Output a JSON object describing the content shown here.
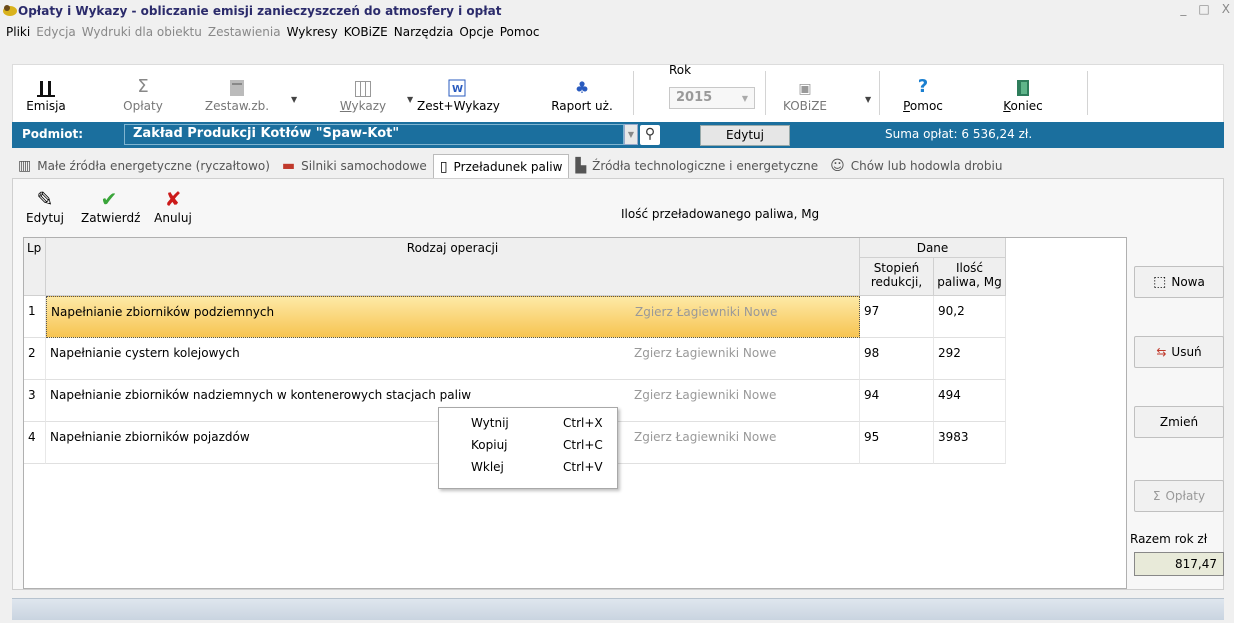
{
  "window": {
    "title": "Opłaty i Wykazy  - obliczanie emisji zanieczyszczeń do atmosfery i opłat",
    "controls": [
      "_",
      "□",
      "X"
    ]
  },
  "menu": [
    {
      "label": "Pliki",
      "enabled": true
    },
    {
      "label": "Edycja",
      "enabled": false
    },
    {
      "label": "Wydruki dla obiektu",
      "enabled": false
    },
    {
      "label": "Zestawienia",
      "enabled": false
    },
    {
      "label": "Wykresy",
      "enabled": true
    },
    {
      "label": "KOBiZE",
      "enabled": true
    },
    {
      "label": "Narzędzia",
      "enabled": true
    },
    {
      "label": "Opcje",
      "enabled": true
    },
    {
      "label": "Pomoc",
      "enabled": true
    }
  ],
  "toolbar": {
    "emisja": "Emisja",
    "oplaty": "Opłaty",
    "zestaw": "Zestaw.zb.",
    "wykazy": "Wykazy",
    "zest_wykazy": "Zest+Wykazy",
    "raport": "Raport uż.",
    "rok_label": "Rok",
    "rok_value": "2015",
    "kobize": "KOBiZE",
    "pomoc": "Pomoc",
    "koniec": "Koniec"
  },
  "subject": {
    "label": "Podmiot:",
    "value": "Zakład Produkcji Kotłów \"Spaw-Kot\"",
    "edit_button": "Edytuj",
    "sum_text": "Suma opłat:  6 536,24 zł."
  },
  "tabs": [
    {
      "label": "Małe źródła energetyczne (ryczałtowo)",
      "icon": "building-icon",
      "active": false
    },
    {
      "label": "Silniki samochodowe",
      "icon": "car-icon",
      "active": false
    },
    {
      "label": "Przeładunek paliw",
      "icon": "fuel-pump-icon",
      "active": true
    },
    {
      "label": "Źródła technologiczne i energetyczne",
      "icon": "factory-icon",
      "active": false
    },
    {
      "label": "Chów lub hodowla drobiu",
      "icon": "bird-icon",
      "active": false
    }
  ],
  "actions": {
    "edytuj": "Edytuj",
    "zatwierdz": "Zatwierdź",
    "anuluj": "Anuluj"
  },
  "panel_title": "Ilość przeładowanego paliwa, Mg",
  "grid": {
    "headers": {
      "lp": "Lp",
      "rodzaj": "Rodzaj operacji",
      "dane": "Dane",
      "stopien_1": "Stopień",
      "stopien_2": "redukcji,",
      "ilosc_1": "Ilość",
      "ilosc_2": "paliwa, Mg"
    },
    "rows": [
      {
        "lp": "1",
        "rodzaj": "Napełnianie zbiorników podziemnych",
        "lokalizacja": "Zgierz Łagiewniki Nowe",
        "stopien": "97",
        "ilosc": "90,2",
        "selected": true
      },
      {
        "lp": "2",
        "rodzaj": "Napełnianie cystern kolejowych",
        "lokalizacja": "Zgierz Łagiewniki Nowe",
        "stopien": "98",
        "ilosc": "292",
        "selected": false
      },
      {
        "lp": "3",
        "rodzaj": "Napełnianie zbiorników nadziemnych w kontenerowych stacjach paliw",
        "lokalizacja": "Zgierz Łagiewniki Nowe",
        "stopien": "94",
        "ilosc": "494",
        "selected": false
      },
      {
        "lp": "4",
        "rodzaj": "Napełnianie zbiorników pojazdów",
        "lokalizacja": "Zgierz Łagiewniki Nowe",
        "stopien": "95",
        "ilosc": "3983",
        "selected": false
      }
    ]
  },
  "context_menu": [
    {
      "label": "Wytnij",
      "shortcut": "Ctrl+X"
    },
    {
      "label": "Kopiuj",
      "shortcut": "Ctrl+C"
    },
    {
      "label": "Wklej",
      "shortcut": "Ctrl+V"
    }
  ],
  "side_buttons": {
    "nowa": "Nowa",
    "usun": "Usuń",
    "zmien": "Zmień",
    "oplaty": "Opłaty"
  },
  "razem": {
    "label": "Razem rok zł",
    "value": "817,47"
  }
}
